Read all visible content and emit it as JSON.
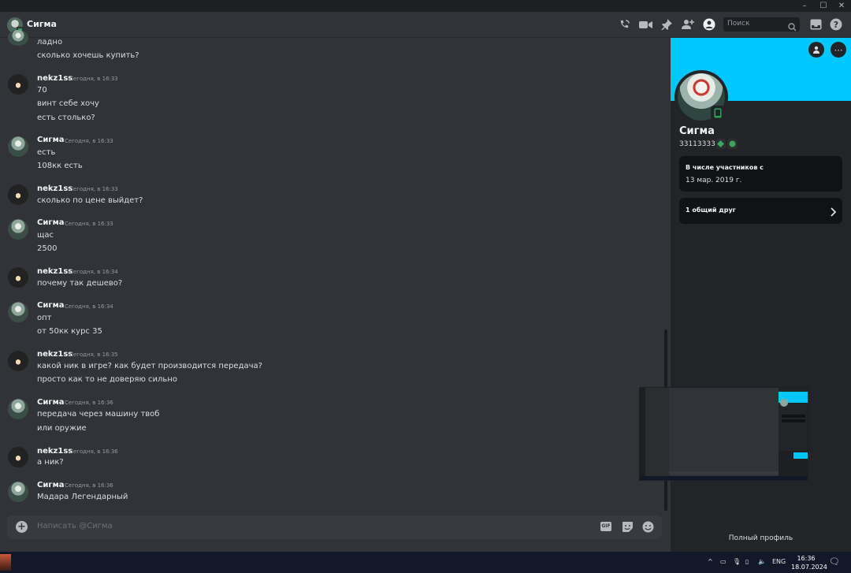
{
  "window": {
    "minimize": "–",
    "maximize": "☐",
    "close": "✕"
  },
  "header": {
    "title": "Сигма",
    "search_placeholder": "Поиск"
  },
  "messages": [
    {
      "user": "",
      "time": "",
      "lines": [
        "ладно",
        "сколько хочешь купить?"
      ]
    },
    {
      "user": "nekz1ss",
      "time": "Сегодня, в 16:33",
      "lines": [
        "70",
        "винт себе хочу",
        "есть столько?"
      ]
    },
    {
      "user": "Сигма",
      "time": "Сегодня, в 16:33",
      "lines": [
        "есть",
        "108кк есть"
      ]
    },
    {
      "user": "nekz1ss",
      "time": "Сегодня, в 16:33",
      "lines": [
        "сколько по цене выйдет?"
      ]
    },
    {
      "user": "Сигма",
      "time": "Сегодня, в 16:33",
      "lines": [
        "щас",
        "2500"
      ]
    },
    {
      "user": "nekz1ss",
      "time": "Сегодня, в 16:34",
      "lines": [
        "почему так дешево?"
      ]
    },
    {
      "user": "Сигма",
      "time": "Сегодня, в 16:34",
      "lines": [
        "опт",
        "от 50кк курс 35"
      ]
    },
    {
      "user": "nekz1ss",
      "time": "Сегодня, в 16:35",
      "lines": [
        "какой ник в игре? как будет производится передача?",
        "просто как то не доверяю сильно"
      ]
    },
    {
      "user": "Сигма",
      "time": "Сегодня, в 16:36",
      "lines": [
        "передача через машину твоб",
        "или оружие"
      ]
    },
    {
      "user": "nekz1ss",
      "time": "Сегодня, в 16:36",
      "lines": [
        "а ник?"
      ]
    },
    {
      "user": "Сигма",
      "time": "Сегодня, в 16:36",
      "lines": [
        "Мадара Легендарный"
      ]
    }
  ],
  "composer": {
    "placeholder": "Написать @Сигма",
    "gif_label": "GIF"
  },
  "profile": {
    "name": "Сигма",
    "tag": "33113333",
    "member_since_heading": "В числе участников с",
    "member_since_date": "13 мар. 2019 г.",
    "mutual_friends": "1 общий друг",
    "full_profile": "Полный профиль",
    "banner_color": "#00c8ff"
  },
  "taskbar": {
    "lang": "ENG",
    "time": "16:36",
    "date": "18.07.2024"
  },
  "colors": {
    "online_green": "#23a55a",
    "accent": "#00c8ff"
  }
}
